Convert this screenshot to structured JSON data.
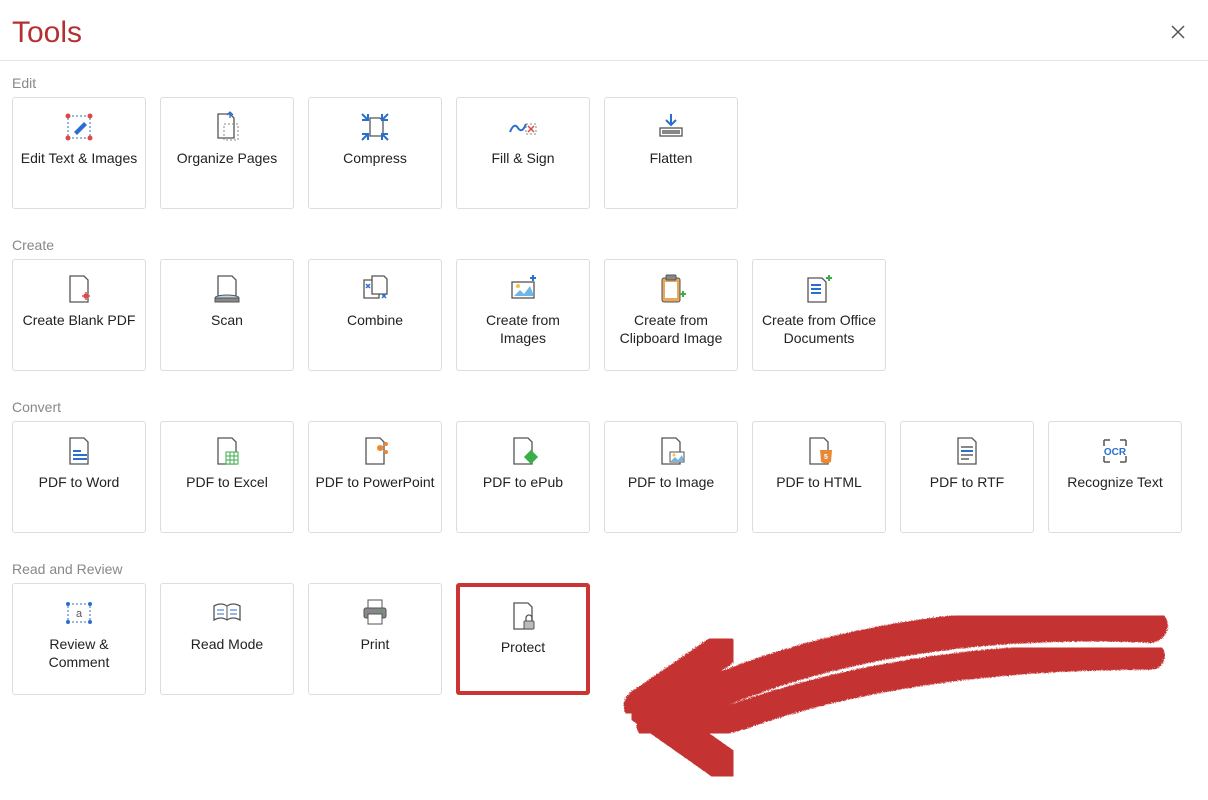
{
  "title": "Tools",
  "sections": [
    {
      "label": "Edit",
      "items": [
        {
          "label": "Edit Text & Images",
          "icon": "edit-text-images-icon"
        },
        {
          "label": "Organize Pages",
          "icon": "organize-pages-icon"
        },
        {
          "label": "Compress",
          "icon": "compress-icon"
        },
        {
          "label": "Fill & Sign",
          "icon": "fill-sign-icon"
        },
        {
          "label": "Flatten",
          "icon": "flatten-icon"
        }
      ]
    },
    {
      "label": "Create",
      "items": [
        {
          "label": "Create Blank PDF",
          "icon": "create-blank-pdf-icon"
        },
        {
          "label": "Scan",
          "icon": "scan-icon"
        },
        {
          "label": "Combine",
          "icon": "combine-icon"
        },
        {
          "label": "Create from Images",
          "icon": "create-from-images-icon"
        },
        {
          "label": "Create from Clipboard Image",
          "icon": "create-from-clipboard-icon"
        },
        {
          "label": "Create from Office Documents",
          "icon": "create-from-office-icon"
        }
      ]
    },
    {
      "label": "Convert",
      "items": [
        {
          "label": "PDF to Word",
          "icon": "pdf-to-word-icon"
        },
        {
          "label": "PDF to Excel",
          "icon": "pdf-to-excel-icon"
        },
        {
          "label": "PDF to PowerPoint",
          "icon": "pdf-to-powerpoint-icon"
        },
        {
          "label": "PDF to ePub",
          "icon": "pdf-to-epub-icon"
        },
        {
          "label": "PDF to Image",
          "icon": "pdf-to-image-icon"
        },
        {
          "label": "PDF to HTML",
          "icon": "pdf-to-html-icon"
        },
        {
          "label": "PDF to RTF",
          "icon": "pdf-to-rtf-icon"
        },
        {
          "label": "Recognize Text",
          "icon": "recognize-text-icon"
        }
      ]
    },
    {
      "label": "Read and Review",
      "items": [
        {
          "label": "Review & Comment",
          "icon": "review-comment-icon"
        },
        {
          "label": "Read Mode",
          "icon": "read-mode-icon"
        },
        {
          "label": "Print",
          "icon": "print-icon"
        },
        {
          "label": "Protect",
          "icon": "protect-icon",
          "highlight": true
        }
      ]
    }
  ],
  "annotation": {
    "type": "arrow",
    "color": "#cc3333",
    "target": "protect-button"
  }
}
